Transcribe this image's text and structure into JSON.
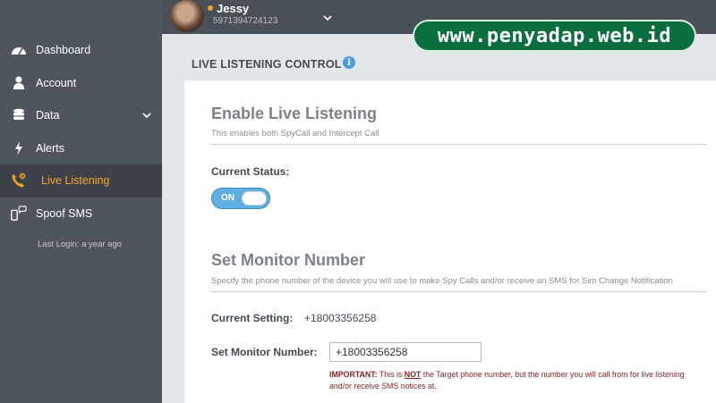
{
  "profile": {
    "name": "Jessy",
    "phone": "5971394724123"
  },
  "sidebar": {
    "items": [
      {
        "label": "Dashboard",
        "icon": "dashboard-gauge-icon"
      },
      {
        "label": "Account",
        "icon": "user-icon"
      },
      {
        "label": "Data",
        "icon": "database-icon"
      },
      {
        "label": "Alerts",
        "icon": "lightning-icon"
      },
      {
        "label": "Live Listening",
        "icon": "phone-waves-icon",
        "active": true
      },
      {
        "label": "Spoof SMS",
        "icon": "phone-chat-icon"
      }
    ],
    "last_login": "Last Login: a year ago"
  },
  "watermark": "www.penyadap.web.id",
  "page": {
    "title": "LIVE LISTENING CONTROL",
    "info_glyph": "i"
  },
  "enable_section": {
    "title": "Enable Live Listening",
    "subtitle": "This enables both SpyCall and Intercept Call",
    "status_label": "Current Status:",
    "toggle_text": "ON",
    "toggle_on": true
  },
  "monitor_section": {
    "title": "Set Monitor Number",
    "subtitle": "Specify the phone number of the device you will use to make Spy Calls and/or receive an SMS for Sim Change Notification",
    "current_label": "Current Setting:",
    "current_value": "+18003356258",
    "set_label": "Set Monitor Number:",
    "input_value": "+18003356258",
    "important_prefix": "IMPORTANT:",
    "important_text_1": "This is",
    "important_not": "NOT",
    "important_text_2": "the Target phone number, but the number you will call from for live listening and/or receive SMS notices at."
  },
  "colors": {
    "sidebar_bg": "#4f555d",
    "active_accent": "#f5a623",
    "toggle_on": "#5fb0e0",
    "watermark_bg": "#0b6e3f",
    "important": "#8b1f1f"
  }
}
